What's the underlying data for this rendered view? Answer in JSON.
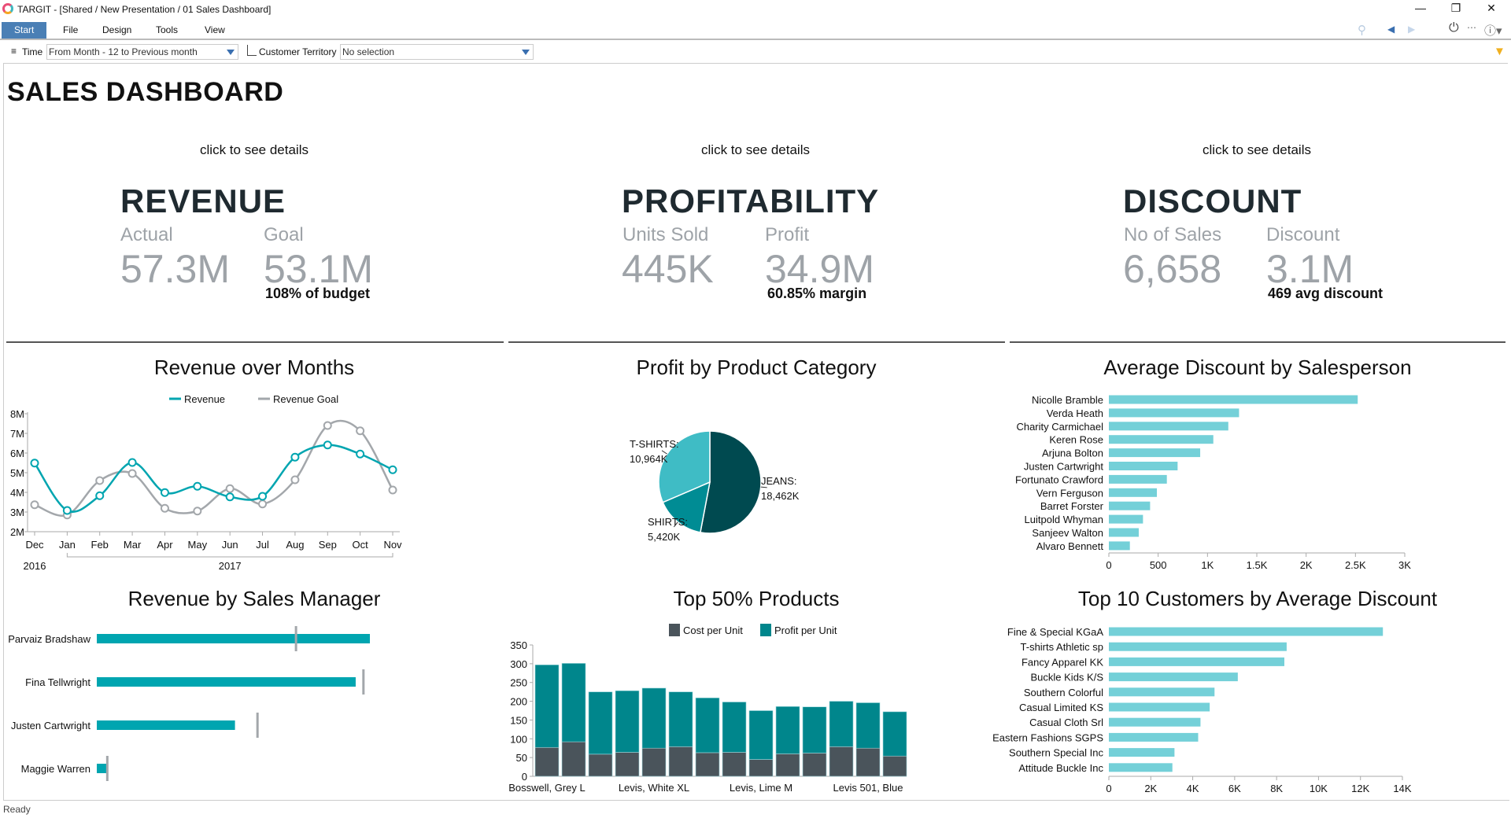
{
  "window": {
    "title": "TARGIT - [Shared / New Presentation / 01 Sales Dashboard]",
    "controls": [
      "minimize-icon",
      "restore-icon",
      "close-icon"
    ]
  },
  "menu": [
    {
      "label": "Start",
      "active": true
    },
    {
      "label": "File"
    },
    {
      "label": "Design"
    },
    {
      "label": "Tools"
    },
    {
      "label": "View"
    }
  ],
  "toolbar_icons": [
    "search-clear-icon",
    "back-arrow-icon",
    "forward-arrow-icon",
    "power-icon",
    "more-icon",
    "help-icon"
  ],
  "filters": {
    "time_label": "Time",
    "time_value": "From Month - 12 to Previous month",
    "territory_label": "Customer Territory",
    "territory_value": "No selection"
  },
  "page_title": "SALES DASHBOARD",
  "kpis": [
    {
      "hint": "click to see details",
      "title": "REVENUE",
      "label1": "Actual",
      "value1": "57.3M",
      "label2": "Goal",
      "value2": "53.1M",
      "sub": "108% of budget"
    },
    {
      "hint": "click to see details",
      "title": "PROFITABILITY",
      "label1": "Units Sold",
      "value1": "445K",
      "label2": "Profit",
      "value2": "34.9M",
      "sub": "60.85% margin"
    },
    {
      "hint": "click to see details",
      "title": "DISCOUNT",
      "label1": "No of Sales",
      "value1": "6,658",
      "label2": "Discount",
      "value2": "3.1M",
      "sub": "469 avg discount"
    }
  ],
  "colors": {
    "revenue": "#00a5b0",
    "goal": "#a3a7ab",
    "discount_bar": "#74d0d8",
    "cost": "#4a545b",
    "profit": "#00868c",
    "jeans": "#004a50",
    "shirts": "#008c94",
    "tshirts": "#3fbcc5",
    "menu_active": "#4a7fb5"
  },
  "chart_data": [
    {
      "type": "line",
      "title": "Revenue over Months",
      "categories": [
        "Dec",
        "Jan",
        "Feb",
        "Mar",
        "Apr",
        "May",
        "Jun",
        "Jul",
        "Aug",
        "Sep",
        "Oct",
        "Nov"
      ],
      "years": [
        {
          "label": "2016",
          "from": 0,
          "to": 0
        },
        {
          "label": "2017",
          "from": 1,
          "to": 11
        }
      ],
      "series": [
        {
          "name": "Revenue",
          "values": [
            5.49,
            3.08,
            3.83,
            5.52,
            3.99,
            4.31,
            3.77,
            3.8,
            5.79,
            6.41,
            5.95,
            5.15
          ]
        },
        {
          "name": "Revenue Goal",
          "values": [
            3.37,
            2.85,
            4.6,
            4.96,
            3.19,
            3.05,
            4.19,
            3.41,
            4.64,
            7.4,
            7.13,
            4.12
          ]
        }
      ],
      "yticks": [
        "2M",
        "3M",
        "4M",
        "5M",
        "6M",
        "7M",
        "8M"
      ],
      "ylim": [
        2,
        8
      ],
      "legend": "top"
    },
    {
      "type": "pie",
      "title": "Profit by Product Category",
      "slices": [
        {
          "label": "JEANS:",
          "value_label": "18,462K",
          "value": 18462
        },
        {
          "label": "SHIRTS:",
          "value_label": "5,420K",
          "value": 5420
        },
        {
          "label": "T-SHIRTS:",
          "value_label": "10,964K",
          "value": 10964
        }
      ]
    },
    {
      "type": "bar",
      "orientation": "horizontal",
      "title": "Average Discount by Salesperson",
      "categories": [
        "Nicolle Bramble",
        "Verda Heath",
        "Charity Carmichael",
        "Keren Rose",
        "Arjuna Bolton",
        "Justen Cartwright",
        "Fortunato Crawford",
        "Vern Ferguson",
        "Barret Forster",
        "Luitpold Whyman",
        "Sanjeev Walton",
        "Alvaro Bennett"
      ],
      "values": [
        2523,
        1320,
        1211,
        1059,
        926,
        697,
        588,
        487,
        418,
        346,
        303,
        213
      ],
      "xlim": [
        0,
        3000
      ],
      "xticks": [
        "0",
        "500",
        "1K",
        "1.5K",
        "2K",
        "2.5K",
        "3K"
      ]
    },
    {
      "type": "bar",
      "orientation": "horizontal",
      "subtype": "bullet",
      "title": "Revenue by Sales Manager",
      "categories": [
        "Parvaiz Bradshaw",
        "Fina Tellwright",
        "Justen Cartwright",
        "Maggie Warren"
      ],
      "values": [
        100,
        94.8,
        50.6,
        4.0
      ],
      "goal_values": [
        72.8,
        97.5,
        58.7,
        3.7
      ]
    },
    {
      "type": "bar",
      "stacked": true,
      "title": "Top 50% Products",
      "categories": [
        "Bosswell, Grey L",
        "",
        "",
        "",
        "Levis, White XL",
        "",
        "",
        "",
        "Levis, Lime M",
        "",
        "",
        "",
        "Levis 501, Blue",
        ""
      ],
      "series": [
        {
          "name": "Cost per Unit",
          "values": [
            77,
            92,
            59,
            64,
            75,
            79,
            63,
            64,
            45,
            60,
            62,
            79,
            75,
            54
          ]
        },
        {
          "name": "Profit per Unit",
          "values": [
            220,
            209,
            166,
            164,
            160,
            146,
            146,
            134,
            130,
            126,
            123,
            121,
            121,
            118
          ]
        }
      ],
      "ylim": [
        0,
        350
      ],
      "yticks": [
        "0",
        "50",
        "100",
        "150",
        "200",
        "250",
        "300",
        "350"
      ],
      "legend": "top"
    },
    {
      "type": "bar",
      "orientation": "horizontal",
      "title": "Top 10 Customers by Average Discount",
      "categories": [
        "Fine & Special KGaA",
        "T-shirts Athletic sp",
        "Fancy Apparel KK",
        "Buckle Kids K/S",
        "Southern Colorful",
        "Casual Limited KS",
        "Casual Cloth Srl",
        "Eastern Fashions SGPS",
        "Southern Special Inc",
        "Attitude Buckle Inc"
      ],
      "values": [
        13070,
        8480,
        8370,
        6150,
        5040,
        4810,
        4370,
        4260,
        3130,
        3030
      ],
      "xlim": [
        0,
        14000
      ],
      "xticks": [
        "0",
        "2K",
        "4K",
        "6K",
        "8K",
        "10K",
        "12K",
        "14K"
      ]
    }
  ],
  "status": "Ready"
}
